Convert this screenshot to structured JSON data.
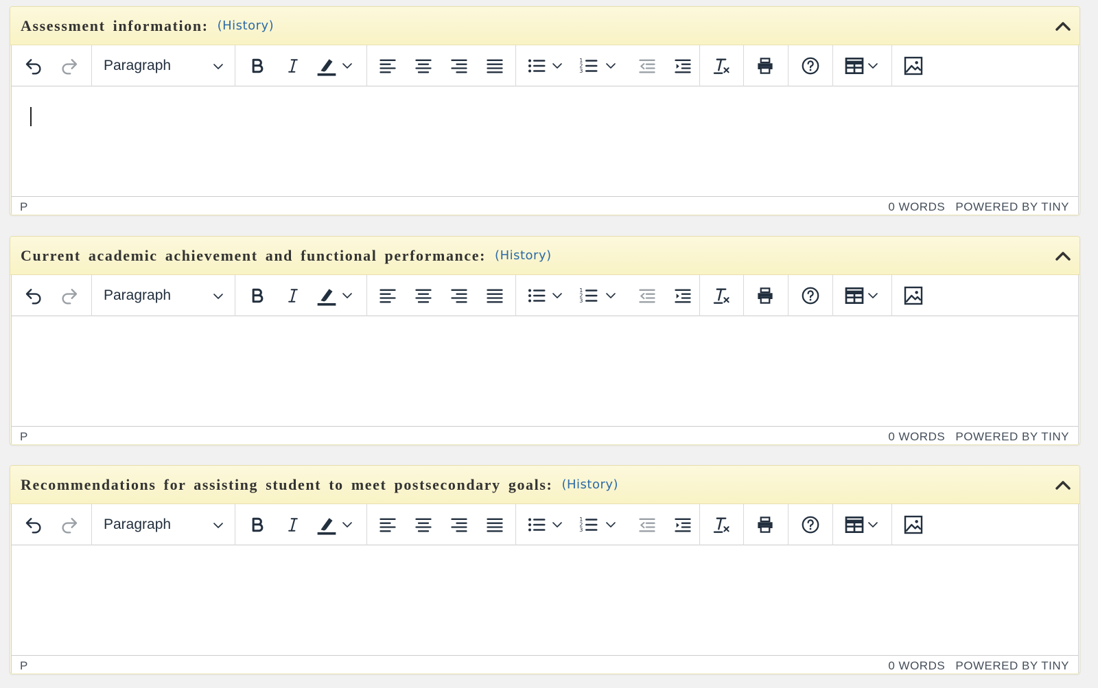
{
  "sections": [
    {
      "title": "Assessment information:",
      "history_label": "(History)",
      "has_caret": true,
      "format_value": "Paragraph",
      "status_path": "P",
      "word_count": "0 WORDS",
      "branding": "POWERED BY TINY"
    },
    {
      "title": "Current academic achievement and functional performance:",
      "history_label": "(History)",
      "has_caret": false,
      "format_value": "Paragraph",
      "status_path": "P",
      "word_count": "0 WORDS",
      "branding": "POWERED BY TINY"
    },
    {
      "title": "Recommendations for assisting student to meet postsecondary goals:",
      "history_label": "(History)",
      "has_caret": false,
      "format_value": "Paragraph",
      "status_path": "P",
      "word_count": "0 WORDS",
      "branding": "POWERED BY TINY"
    }
  ],
  "toolbar_icons": [
    "undo-icon",
    "redo-icon",
    "bold-icon",
    "italic-icon",
    "highlight-icon",
    "align-left-icon",
    "align-center-icon",
    "align-right-icon",
    "align-justify-icon",
    "bullet-list-icon",
    "numbered-list-icon",
    "outdent-icon",
    "indent-icon",
    "clear-formatting-icon",
    "print-icon",
    "help-icon",
    "table-icon",
    "image-icon"
  ],
  "colors": {
    "header_bg": "#f9f3c5",
    "history_link": "#2c6aa6",
    "icon": "#222f3e",
    "icon_disabled": "#9aa0a6"
  }
}
